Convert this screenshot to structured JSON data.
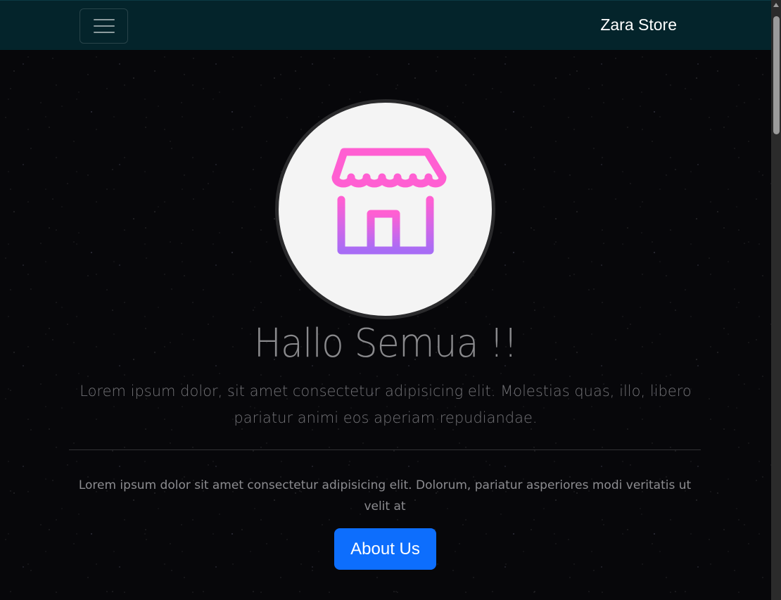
{
  "navbar": {
    "brand": "Zara Store",
    "toggler_icon": "hamburger-menu-icon"
  },
  "hero": {
    "logo_icon": "store-icon",
    "title": "Hallo Semua !!",
    "lead": "Lorem ipsum dolor, sit amet consectetur adipisicing elit. Molestias quas, illo, libero pariatur animi eos aperiam repudiandae.",
    "description": "Lorem ipsum dolor sit amet consectetur adipisicing elit. Dolorum, pariatur asperiores modi veritatis ut velit at",
    "button_label": "About Us"
  },
  "colors": {
    "navbar_bg": "#04242b",
    "button_bg": "#0d6efd",
    "icon_pink": "#ff5fd2",
    "icon_purple": "#b36cf5"
  }
}
